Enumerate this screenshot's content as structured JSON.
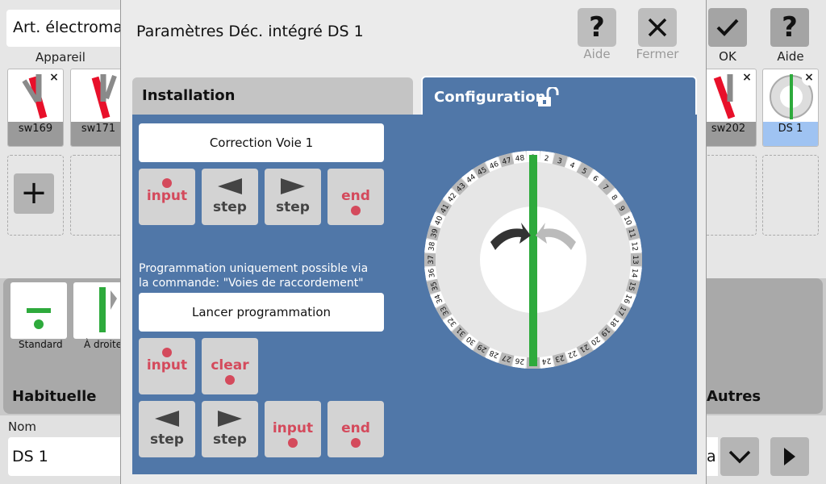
{
  "background": {
    "art_field": "Art. électromag",
    "appareil_label": "Appareil",
    "tiles": [
      {
        "name": "sw169"
      },
      {
        "name": "sw171"
      },
      {
        "name": "sw202"
      },
      {
        "name": "DS 1"
      }
    ],
    "ok_label": "OK",
    "aide_label": "Aide",
    "categories": [
      {
        "label": "Standard"
      },
      {
        "label": "À droite"
      }
    ],
    "habituelle_label": "Habituelle",
    "autres_label": "Autres",
    "nom_label": "Nom",
    "nom_value": "DS 1",
    "partial_text": "a"
  },
  "dialog": {
    "title": "Paramètres Déc. intégré DS 1",
    "aide_label": "Aide",
    "fermer_label": "Fermer",
    "tabs": {
      "installation": "Installation",
      "configuration": "Configuration"
    },
    "correction_button": "Correction Voie 1",
    "row1": [
      {
        "label": "input",
        "dot": "top",
        "style": "red"
      },
      {
        "label": "step",
        "arrow": "left",
        "style": "dark"
      },
      {
        "label": "step",
        "arrow": "right",
        "style": "dark"
      },
      {
        "label": "end",
        "dot": "bottom",
        "style": "red"
      }
    ],
    "info_text_1": "Programmation uniquement possible via",
    "info_text_2": "la commande: \"Voies de raccordement\"",
    "lancer_button": "Lancer programmation",
    "row2": [
      {
        "label": "input",
        "dot": "top",
        "style": "red"
      },
      {
        "label": "clear",
        "dot": "bottom",
        "style": "red"
      }
    ],
    "row3": [
      {
        "label": "step",
        "arrow": "left",
        "style": "dark"
      },
      {
        "label": "step",
        "arrow": "right",
        "style": "dark"
      },
      {
        "label": "input",
        "dot": "bottom",
        "style": "red"
      },
      {
        "label": "end",
        "dot": "bottom",
        "style": "red"
      }
    ],
    "turntable": {
      "tracks": [
        "1",
        "2",
        "3",
        "4",
        "5",
        "6",
        "7",
        "8",
        "9",
        "10",
        "11",
        "12",
        "13",
        "14",
        "15",
        "16",
        "17",
        "18",
        "19",
        "20",
        "21",
        "22",
        "23",
        "24",
        "25",
        "26",
        "27",
        "28",
        "29",
        "30",
        "31",
        "32",
        "33",
        "34",
        "35",
        "36",
        "37",
        "38",
        "39",
        "40",
        "41",
        "42",
        "43",
        "44",
        "45",
        "46",
        "47",
        "48"
      ],
      "selected_track": "1"
    }
  },
  "colors": {
    "panel": "#5077a8",
    "accent_red": "#d44a5c",
    "track_green": "#2eaa3c"
  }
}
